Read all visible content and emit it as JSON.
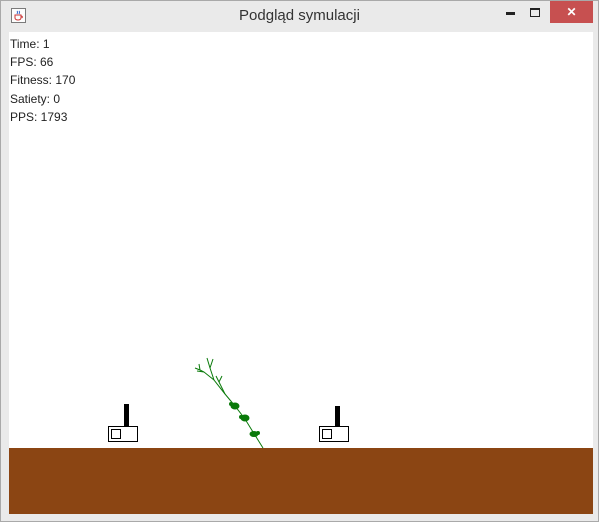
{
  "window": {
    "title": "Podgląd symulacji",
    "minimize_glyph": "▬",
    "maximize_glyph": "☐",
    "close_glyph": "✕",
    "icon": "java-cup-icon"
  },
  "hud": {
    "time": "Time: 1",
    "fps": "FPS: 66",
    "fitness": "Fitness: 170",
    "satiety": "Satiety: 0",
    "pps": "PPS: 1793"
  },
  "colors": {
    "ground": "#8b4513",
    "plant": "#0a7a0a",
    "close_button": "#c75050",
    "creature_stroke": "#000000"
  },
  "scene": {
    "creatures": [
      "creature-left",
      "creature-right"
    ],
    "plant": "green-plant"
  }
}
